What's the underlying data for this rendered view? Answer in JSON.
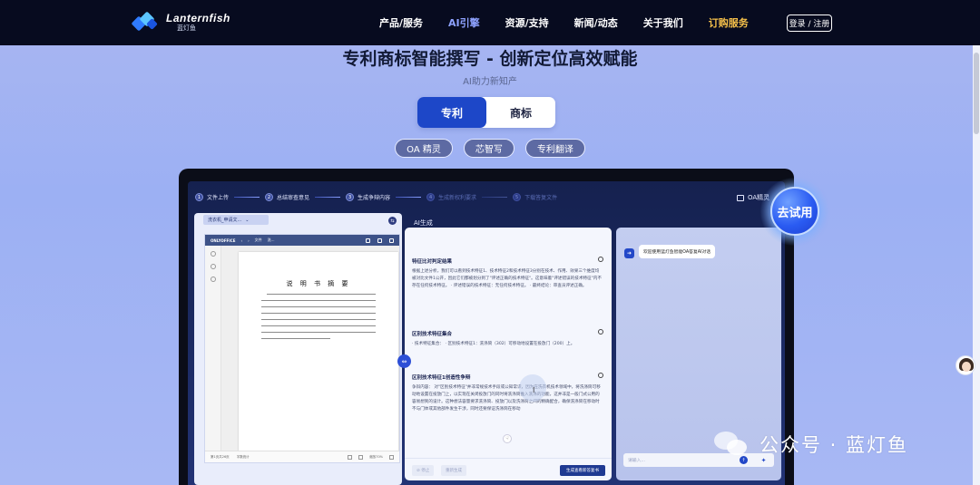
{
  "nav": {
    "logo_en": "Lanternfish",
    "logo_zh": "蓝灯鱼",
    "items": [
      "产品/服务",
      "AI引擎",
      "资源/支持",
      "新闻/动态",
      "关于我们",
      "订购服务"
    ],
    "login": "登录 / 注册"
  },
  "hero": {
    "title": "专利商标智能撰写 - 创新定位高效赋能",
    "subtitle": "AI助力新知产",
    "tabs": [
      "专利",
      "商标"
    ],
    "pills": [
      "OA 精灵",
      "芯智写",
      "专利翻译"
    ]
  },
  "app": {
    "steps": [
      "文件上传",
      "总结审查意见",
      "生成争辩内容",
      "生成新权利要求",
      "下载答复文件"
    ],
    "step_nums": [
      "1",
      "2",
      "3",
      "4",
      "5"
    ],
    "oa_label": "OA精灵",
    "file_select": "洗衣机_申请文...",
    "ai_generate": "AI生成",
    "doc": {
      "app_name": "ONLYOFFICE",
      "tab": "文件",
      "tab2": "洗...",
      "title": "说 明 书 摘 要",
      "status_left": "第1页共26页",
      "status_lang": "字数统计",
      "zoom": "缩放70%"
    },
    "sections": [
      {
        "title": "特征比对判定结果",
        "text": "根据上述分析，我们可以看到技术特征1、技术特征2和技术特征3分别在技术、作用、效果三个维度均被对比文件1公开，因此它们都被划分到了\"评述正确的技术特征\"。这意味着\"评述错误的技术特征\"内不存在任何技术特征。 · 评述错误的技术特征：无任何技术特征。 · 最终结论：审查员评述正确。"
      },
      {
        "title": "区别技术特征集合",
        "text": "· 技术特征集合： · 区别技术特征1：洗涤筒（302）可移动地设置在投放门（200）上。"
      },
      {
        "title": "区别技术特征1创造性争辩",
        "text": "争辩内容： 对\"区别技术特征\"并非常规技术手段或公知常识，因为在洗衣机技术领域中，将洗涤筒可移动地设置在投放门上，以实现在关闭投放门的同时将洗涤筒推入洗涤的功能，这并非是一般门式公用的容易想到的设计。这种想法容量要求洗涤筒、投放门以及洗涤筒之间的精确配合，确保洗涤筒在移动时不与门体或其他部件发生干涉，同时还要保证洗涤筒在移动"
      }
    ],
    "footer": {
      "stop": "停止",
      "regen": "重新生成",
      "generate": "生成查看新答复书"
    },
    "chat": {
      "welcome": "欢迎使用蓝灯鱼智能OA答复AI对话",
      "placeholder": "请输入..."
    }
  },
  "try_button": "去试用",
  "watermark": "公众号 · 蓝灯鱼"
}
